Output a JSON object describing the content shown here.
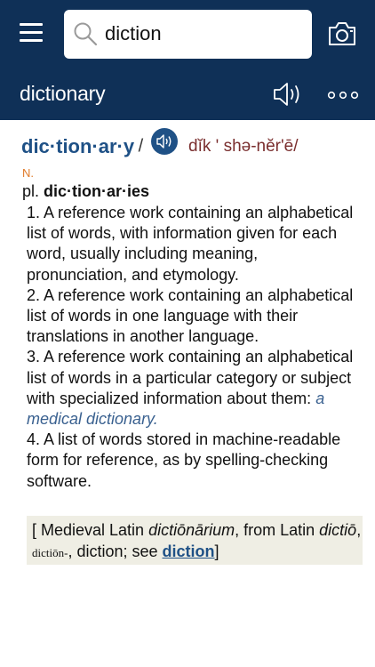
{
  "search": {
    "value": "diction",
    "placeholder": ""
  },
  "header": {
    "title": "dictionary"
  },
  "entry": {
    "headword": "dic·tion·ar·y",
    "slash_open": "/",
    "pronunciation": "dĭk ' shə-nĕr'ē/",
    "part_of_speech": "N.",
    "plural_label": "pl.",
    "plural_form": "dic·tion·ar·ies",
    "senses": [
      {
        "text": "1. A reference work containing an alphabetical list of words, with information given for each word, usually including meaning, pronunciation, and etymology.",
        "example": ""
      },
      {
        "text": "2. A reference work containing an alphabetical list of words in one language with their translations in another language.",
        "example": ""
      },
      {
        "text": "3. A reference work containing an alphabetical list of words in a particular category or subject with specialized information about them:",
        "example": "a medical dictionary."
      },
      {
        "text": "4. A list of words stored in machine-readable form for reference, as by spelling-checking software.",
        "example": ""
      }
    ],
    "etymology": {
      "p1": "[ Medieval Latin ",
      "w1": "dictiōnārium",
      "p2": ", from Latin ",
      "w2": "dictiō",
      "p3": ", ",
      "w3": "dictiōn-",
      "p4": ", diction; see ",
      "link": "diction",
      "p5": "]"
    }
  },
  "colors": {
    "header_bg": "#0f3057",
    "accent": "#1f5186",
    "pos": "#e07b2a",
    "pron": "#7a2e2e",
    "etym_bg": "#efeee4"
  },
  "icons": [
    "menu-icon",
    "search-icon",
    "camera-icon",
    "speaker-icon",
    "more-icon",
    "audio-icon"
  ]
}
